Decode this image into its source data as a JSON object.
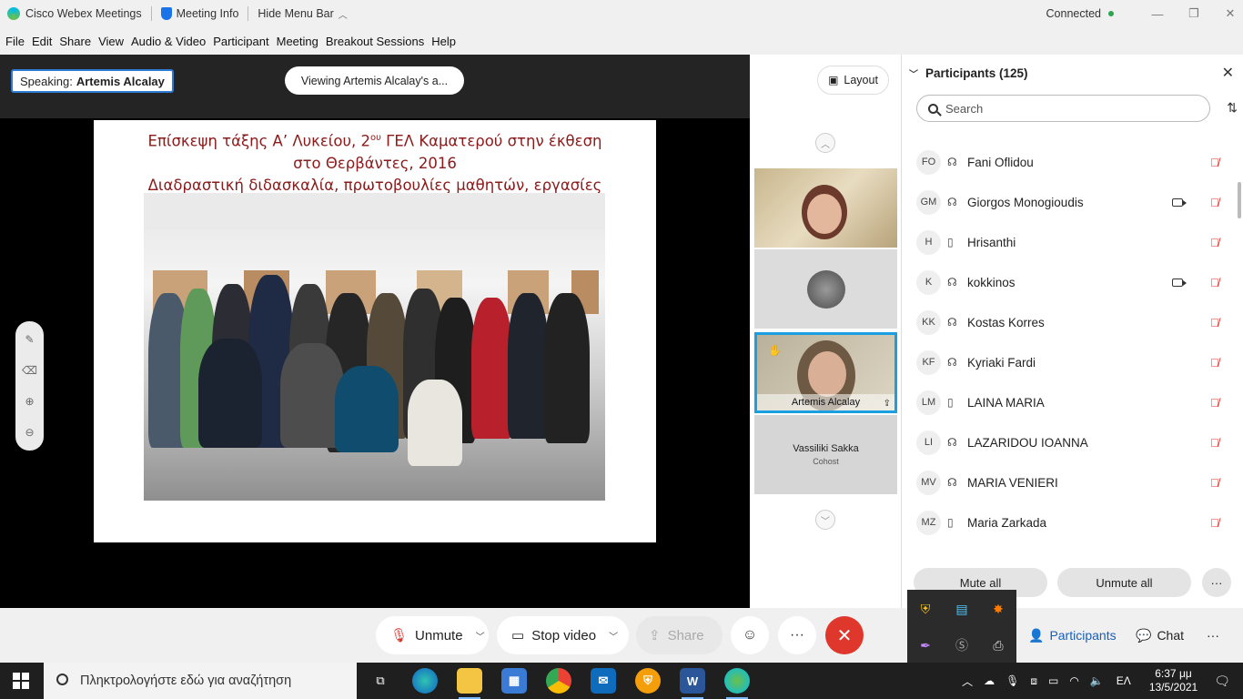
{
  "titlebar": {
    "app_name": "Cisco Webex Meetings",
    "meeting_info": "Meeting Info",
    "hide_menu": "Hide Menu Bar",
    "status": "Connected"
  },
  "menu": [
    "File",
    "Edit",
    "Share",
    "View",
    "Audio & Video",
    "Participant",
    "Meeting",
    "Breakout Sessions",
    "Help"
  ],
  "stage": {
    "speaking_label": "Speaking:",
    "speaking_name": "Artemis Alcalay",
    "viewing": "Viewing Artemis Alcalay's a...",
    "slide_title_1a": "Επίσκεψη τάξης Α’ Λυκείου, 2",
    "slide_title_1sup": "ου",
    "slide_title_1b": " ΓΕΛ Καματερού στην έκθεση",
    "slide_title_2": "στο Θερβάντες, 2016",
    "slide_title_3": "Διαδραστική διδασκαλία, πρωτοβουλίες μαθητών, εργασίες"
  },
  "filmstrip": {
    "layout_label": "Layout",
    "active_name": "Artemis Alcalay",
    "cohost_name": "Vassiliki Sakka",
    "cohost_role": "Cohost"
  },
  "participants": {
    "title": "Participants (125)",
    "search_placeholder": "Search",
    "list": [
      {
        "initials": "FO",
        "name": "Fani Oflidou",
        "device": "headset",
        "video": false
      },
      {
        "initials": "GM",
        "name": "Giorgos Monogioudis",
        "device": "headset",
        "video": true
      },
      {
        "initials": "H",
        "name": "Hrisanthi",
        "device": "phone",
        "video": false
      },
      {
        "initials": "K",
        "name": "kokkinos",
        "device": "headset",
        "video": true
      },
      {
        "initials": "KK",
        "name": "Kostas Korres",
        "device": "headset",
        "video": false
      },
      {
        "initials": "KF",
        "name": "Kyriaki Fardi",
        "device": "headset",
        "video": false
      },
      {
        "initials": "LM",
        "name": "LAINA MARIA",
        "device": "phone",
        "video": false
      },
      {
        "initials": "LI",
        "name": "LAZARIDOU IOANNA",
        "device": "headset",
        "video": false
      },
      {
        "initials": "MV",
        "name": "MARIA VENIERI",
        "device": "headset",
        "video": false
      },
      {
        "initials": "MZ",
        "name": "Maria Zarkada",
        "device": "phone",
        "video": false
      }
    ],
    "mute_all": "Mute all",
    "unmute_all": "Unmute all",
    "more": "···"
  },
  "controls": {
    "unmute": "Unmute",
    "stop_video": "Stop video",
    "share": "Share",
    "participants": "Participants",
    "chat": "Chat"
  },
  "taskbar": {
    "search_placeholder": "Πληκτρολογήστε εδώ για αναζήτηση",
    "lang": "ΕΛ",
    "time": "6:37 μμ",
    "date": "13/5/2021"
  },
  "colors": {
    "accent_blue": "#1a9fe0",
    "end_red": "#e0372d",
    "muted_red": "#d9362c",
    "slide_title": "#8b1a1a"
  }
}
